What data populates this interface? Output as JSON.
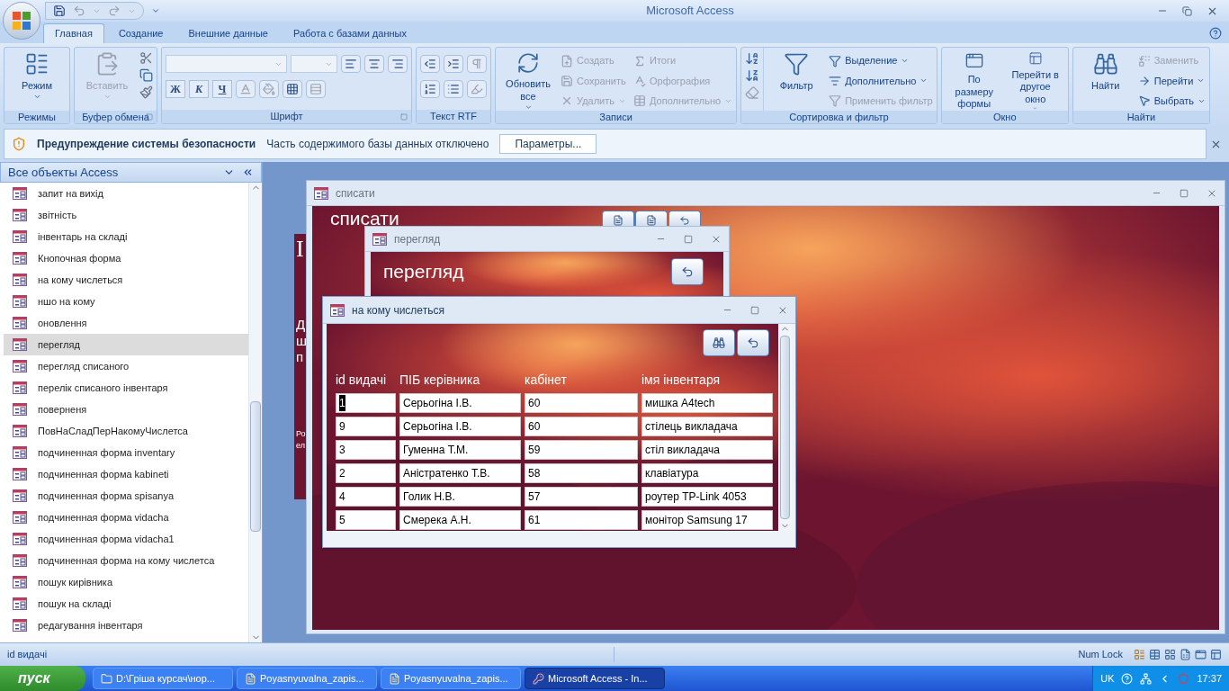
{
  "app": {
    "title": "Microsoft Access"
  },
  "ribbon_tabs": [
    {
      "label": "Главная",
      "selected": true
    },
    {
      "label": "Создание",
      "selected": false
    },
    {
      "label": "Внешние данные",
      "selected": false
    },
    {
      "label": "Работа с базами данных",
      "selected": false
    }
  ],
  "ribbon_groups": [
    {
      "label": "Режимы",
      "launcher": false,
      "commands": [
        {
          "label": "Режим",
          "kind": "large",
          "disabled": false,
          "dropdown": true
        }
      ]
    },
    {
      "label": "Буфер обмена",
      "launcher": true,
      "commands": [
        {
          "label": "Вставить",
          "kind": "large",
          "disabled": true,
          "dropdown": true
        }
      ]
    },
    {
      "label": "Шрифт",
      "launcher": true,
      "format_buttons": [
        "Ж",
        "К",
        "Ч"
      ]
    },
    {
      "label": "Текст RTF",
      "launcher": false
    },
    {
      "label": "Записи",
      "launcher": false,
      "commands": [
        {
          "label": "Обновить все",
          "kind": "large",
          "disabled": false,
          "dropdown": true
        },
        {
          "label": "Создать",
          "kind": "small",
          "disabled": true,
          "dropdown": false
        },
        {
          "label": "Сохранить",
          "kind": "small",
          "disabled": true,
          "dropdown": false
        },
        {
          "label": "Удалить",
          "kind": "small",
          "disabled": true,
          "dropdown": true
        },
        {
          "label": "Итоги",
          "kind": "small",
          "disabled": true,
          "dropdown": false
        },
        {
          "label": "Орфография",
          "kind": "small",
          "disabled": true,
          "dropdown": false
        },
        {
          "label": "Дополнительно",
          "kind": "small",
          "disabled": true,
          "dropdown": true
        }
      ]
    },
    {
      "label": "Сортировка и фильтр",
      "launcher": false,
      "commands": [
        {
          "label": "Фильтр",
          "kind": "large",
          "disabled": false,
          "dropdown": false
        },
        {
          "label": "Выделение",
          "kind": "small",
          "disabled": false,
          "dropdown": true
        },
        {
          "label": "Дополнительно",
          "kind": "small",
          "disabled": false,
          "dropdown": true
        },
        {
          "label": "Применить фильтр",
          "kind": "small",
          "disabled": true,
          "dropdown": false
        }
      ]
    },
    {
      "label": "Окно",
      "launcher": false,
      "commands": [
        {
          "label": "По размеру формы",
          "kind": "large",
          "disabled": false,
          "dropdown": false
        },
        {
          "label": "Перейти в другое окно",
          "kind": "large",
          "disabled": false,
          "dropdown": true
        }
      ]
    },
    {
      "label": "Найти",
      "launcher": false,
      "commands": [
        {
          "label": "Найти",
          "kind": "large",
          "disabled": false,
          "dropdown": false
        },
        {
          "label": "Заменить",
          "kind": "small",
          "disabled": true,
          "dropdown": false
        },
        {
          "label": "Перейти",
          "kind": "small",
          "disabled": false,
          "dropdown": true
        },
        {
          "label": "Выбрать",
          "kind": "small",
          "disabled": false,
          "dropdown": true
        }
      ]
    }
  ],
  "security_bar": {
    "title": "Предупреждение системы безопасности",
    "message": "Часть содержимого базы данных отключено",
    "button": "Параметры..."
  },
  "nav_pane": {
    "title": "Все объекты Access",
    "items": [
      {
        "label": "запит на вихід",
        "selected": false
      },
      {
        "label": "звітність",
        "selected": false
      },
      {
        "label": "інвентарь на складі",
        "selected": false
      },
      {
        "label": "Кнопочная форма",
        "selected": false
      },
      {
        "label": "на кому числеться",
        "selected": false
      },
      {
        "label": "ншо на кому",
        "selected": false
      },
      {
        "label": "оновлення",
        "selected": false
      },
      {
        "label": "перегляд",
        "selected": true
      },
      {
        "label": "перегляд списаного",
        "selected": false
      },
      {
        "label": "перелік списаного інвентаря",
        "selected": false
      },
      {
        "label": "поверненя",
        "selected": false
      },
      {
        "label": "ПовНаСладПерНакомуЧислетса",
        "selected": false
      },
      {
        "label": "подчиненная форма inventary",
        "selected": false
      },
      {
        "label": "подчиненная форма kabineti",
        "selected": false
      },
      {
        "label": "подчиненная форма spisanya",
        "selected": false
      },
      {
        "label": "подчиненная форма vidacha",
        "selected": false
      },
      {
        "label": "подчиненная форма vidacha1",
        "selected": false
      },
      {
        "label": "подчиненная форма на кому числетса",
        "selected": false
      },
      {
        "label": "пошук кирівника",
        "selected": false
      },
      {
        "label": "пошук на складі",
        "selected": false
      },
      {
        "label": "редагування інвентаря",
        "selected": false
      }
    ]
  },
  "background_form": {
    "fragments": [
      "І",
      "Д",
      "ш",
      "п",
      "Ро",
      "ел"
    ]
  },
  "windows": [
    {
      "title": "списати",
      "active": false,
      "heading": "списати"
    },
    {
      "title": "перегляд",
      "active": false,
      "heading": "перегляд"
    },
    {
      "title": "на кому числеться",
      "active": true,
      "columns": [
        "id видачі",
        "ПІБ керівника",
        "кабінет",
        "імя інвентаря"
      ],
      "rows": [
        {
          "cells": [
            "1",
            "Серьогіна І.В.",
            "60",
            "мишка A4tech"
          ],
          "focused": true
        },
        {
          "cells": [
            "9",
            "Серьогіна І.В.",
            "60",
            "стілець викладача"
          ],
          "focused": false
        },
        {
          "cells": [
            "3",
            "Гуменна Т.М.",
            "59",
            "стіл викладача"
          ],
          "focused": false
        },
        {
          "cells": [
            "2",
            "Аністратенко Т.В.",
            "58",
            "клавіатура"
          ],
          "focused": false
        },
        {
          "cells": [
            "4",
            "Голик Н.В.",
            "57",
            "роутер TP-Link 4053"
          ],
          "focused": false
        },
        {
          "cells": [
            "5",
            "Смерека А.Н.",
            "61",
            "монітор Samsung 17"
          ],
          "focused": false
        }
      ]
    }
  ],
  "status_bar": {
    "left": "id видачі",
    "right": "Num Lock"
  },
  "taskbar": {
    "start": "пуск",
    "tasks": [
      {
        "label": "D:\\Гріша курсач\\нор...",
        "selected": false
      },
      {
        "label": "Poyasnyuvalna_zapis...",
        "selected": false
      },
      {
        "label": "Poyasnyuvalna_zapis...",
        "selected": false
      },
      {
        "label": "Microsoft Access - In...",
        "selected": true
      }
    ],
    "language": "UK",
    "clock": "17:37"
  }
}
